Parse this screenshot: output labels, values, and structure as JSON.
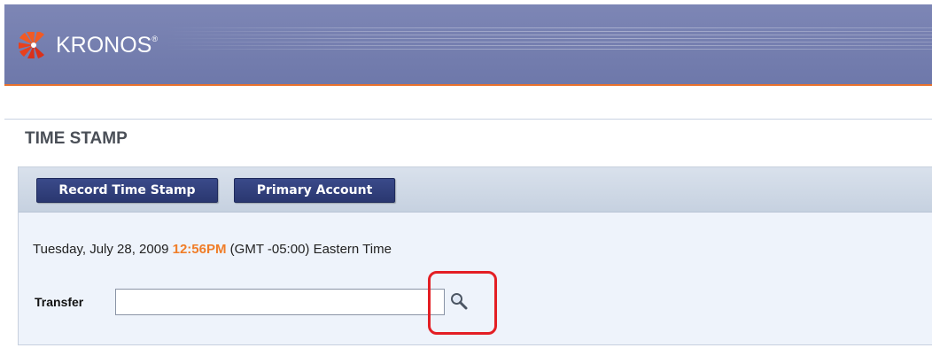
{
  "header": {
    "logo_text": "KRONOS",
    "logo_mark": "®",
    "logo_icon": "kronos-sunburst-icon",
    "accent_color": "#e8722d",
    "bar_color": "#7d86b5"
  },
  "page": {
    "title": "TIME STAMP"
  },
  "toolbar": {
    "record_label": "Record Time Stamp",
    "primary_label": "Primary Account"
  },
  "datetime": {
    "date_text": "Tuesday, July 28, 2009",
    "time_text": "12:56PM",
    "zone_text": "(GMT -05:00) Eastern Time",
    "time_color": "#f07d28"
  },
  "transfer": {
    "label": "Transfer",
    "value": "",
    "search_icon": "search-icon"
  },
  "highlight": {
    "color": "#e31e24"
  }
}
